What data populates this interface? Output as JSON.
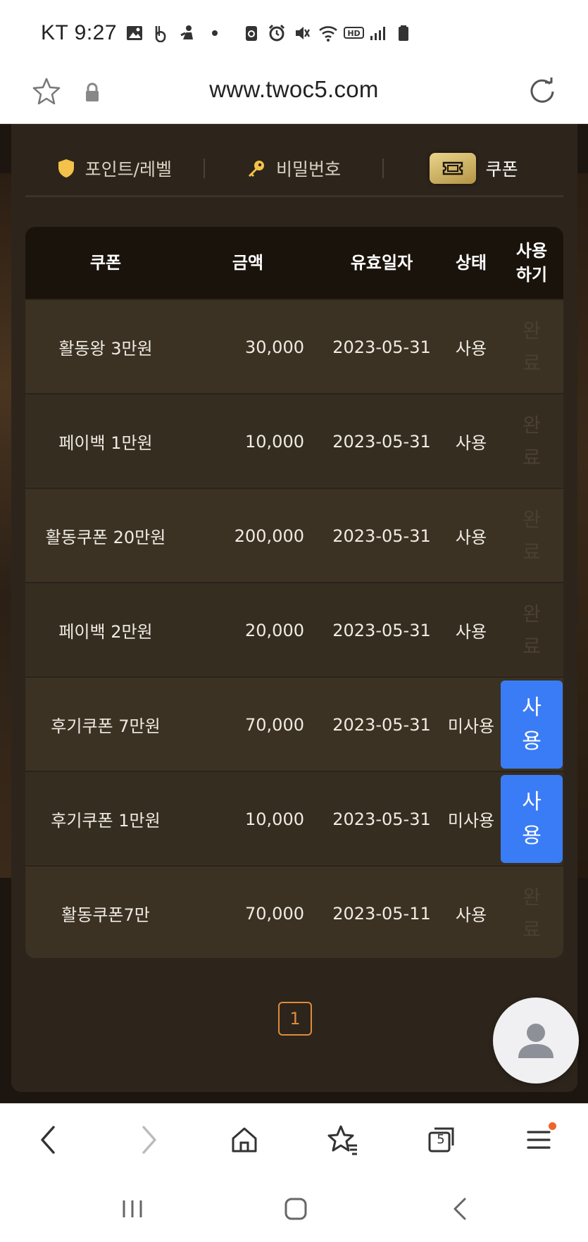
{
  "status_bar": {
    "carrier_time": "KT 9:27",
    "icons_left": [
      "gallery-icon",
      "b-app-icon",
      "app-icon",
      "dot-icon"
    ],
    "icons_right": [
      "recycle-icon",
      "alarm-icon",
      "mute-icon",
      "wifi-icon",
      "hd-icon",
      "signal-icon",
      "battery-icon"
    ]
  },
  "browser": {
    "url": "www.twoc5.com",
    "tab_count": "5"
  },
  "tabs": [
    {
      "label": "포인트/레벨",
      "icon": "shield-icon"
    },
    {
      "label": "비밀번호",
      "icon": "key-icon"
    },
    {
      "label": "쿠폰",
      "icon": "ticket-icon",
      "active": true
    }
  ],
  "table": {
    "headers": [
      "쿠폰",
      "금액",
      "유효일자",
      "상태",
      "사용하기"
    ],
    "rows": [
      {
        "name": "활동왕 3만원",
        "amount": "30,000",
        "date": "2023-05-31",
        "status": "사용",
        "action": "완료"
      },
      {
        "name": "페이백 1만원",
        "amount": "10,000",
        "date": "2023-05-31",
        "status": "사용",
        "action": "완료"
      },
      {
        "name": "활동쿠폰 20만원",
        "amount": "200,000",
        "date": "2023-05-31",
        "status": "사용",
        "action": "완료"
      },
      {
        "name": "페이백 2만원",
        "amount": "20,000",
        "date": "2023-05-31",
        "status": "사용",
        "action": "완료"
      },
      {
        "name": "후기쿠폰 7만원",
        "amount": "70,000",
        "date": "2023-05-31",
        "status": "미사용",
        "action": "사용"
      },
      {
        "name": "후기쿠폰 1만원",
        "amount": "10,000",
        "date": "2023-05-31",
        "status": "미사용",
        "action": "사용"
      },
      {
        "name": "활동쿠폰7만",
        "amount": "70,000",
        "date": "2023-05-11",
        "status": "사용",
        "action": "완료"
      }
    ]
  },
  "pagination": {
    "current": "1"
  },
  "colors": {
    "accent_blue": "#3a7cf5",
    "page_orange": "#e08a3c",
    "panel_bg": "#2d251b",
    "header_bg": "#1a130c",
    "ticket_gold": "#d4b968"
  }
}
